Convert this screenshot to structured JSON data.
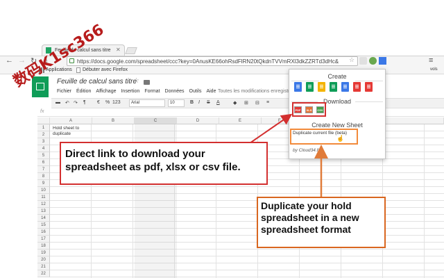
{
  "browser": {
    "tab_title": "Feuille de calcul sans titre",
    "url": "https://docs.google.com/spreadsheet/ccc?key=0AnusKE66ohRsdFlRN20tQkdnTVVmRXl3dkZZRTd3dHc&",
    "bookmarks": [
      "Applications",
      "Débuter avec Firefox"
    ],
    "bookmarks_more": "vols"
  },
  "sheet": {
    "title": "Feuille de calcul sans titre",
    "menus": [
      "Fichier",
      "Édition",
      "Affichage",
      "Insertion",
      "Format",
      "Données",
      "Outils",
      "Aide"
    ],
    "saved_status": "Toutes les modifications enregistré",
    "toolbar": {
      "currency": "€",
      "percent": "%",
      "number_format": "123",
      "font": "Arial",
      "font_size": "10",
      "bold": "B",
      "italic": "I",
      "strike": "S",
      "text_color": "A"
    },
    "fx_label": "fx",
    "columns": [
      "A",
      "B",
      "C",
      "D",
      "E",
      "F"
    ],
    "rows": [
      "1",
      "2",
      "3",
      "4",
      "5",
      "6",
      "7",
      "8",
      "9",
      "10",
      "11",
      "12",
      "13",
      "14",
      "15",
      "16",
      "17",
      "18",
      "19",
      "20",
      "21",
      "22"
    ],
    "cell_a1": "Hold sheet to duplicate"
  },
  "popup": {
    "create_title": "Create",
    "download_title": "Download",
    "create_new_title": "Create New Sheet",
    "duplicate_link": "Duplicate current file (beta)",
    "byline": "by Cloud34.fr",
    "download_formats": [
      "PDF",
      "XLS",
      "CSV"
    ],
    "create_icon_colors": [
      "#3b78e7",
      "#0f9d58",
      "#f4b400",
      "#0f9d58",
      "#3b78e7",
      "#e53935",
      "#e53935"
    ]
  },
  "callouts": {
    "download": "Direct link to download your spreadsheet as pdf, xlsx or csv file.",
    "duplicate": "Duplicate your hold spreadsheet in a new spreadsheet format"
  },
  "watermark": "数码K1sc366",
  "colors": {
    "sheets_green": "#0f9d58",
    "download_highlight": "#d32f2f",
    "duplicate_highlight": "#f28a3a"
  }
}
